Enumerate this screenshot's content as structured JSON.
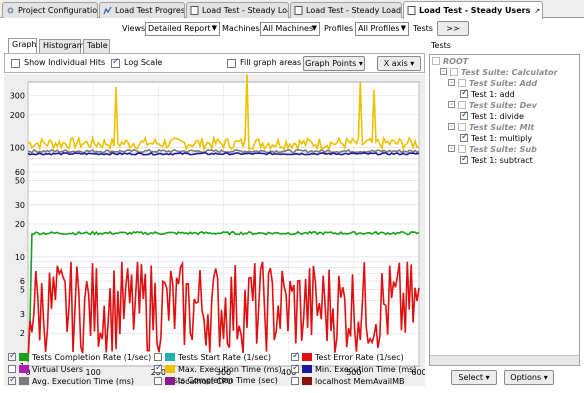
{
  "tabs": [
    {
      "label": "Project Configuration"
    },
    {
      "label": "Load Test Progress"
    },
    {
      "label": "Load Test - Steady Load"
    },
    {
      "label": "Load Test - Steady Load 2"
    },
    {
      "label": "Load Test - Steady Users"
    }
  ],
  "filters": {
    "views_label": "Views",
    "views_value": "Detailed Report",
    "machines_label": "Machines",
    "machines_value": "All Machines",
    "profiles_label": "Profiles",
    "profiles_value": "All Profiles",
    "tests_label": "Tests",
    "more_label": ">>"
  },
  "panel_tabs": [
    "Graph",
    "Histogram",
    "Table"
  ],
  "options": {
    "show_individual_hits": "Show Individual Hits",
    "show_individual_hits_checked": false,
    "log_scale": "Log Scale",
    "log_scale_checked": true,
    "fill_graph_areas": "Fill graph areas",
    "fill_graph_areas_checked": false,
    "graph_points": "Graph Points",
    "x_axis": "X axis"
  },
  "chart_data": {
    "type": "line",
    "xlabel": "Tests Completion Time (sec)",
    "ylabel": "",
    "xlim": [
      0,
      600
    ],
    "ylim": [
      1,
      400
    ],
    "log_y": true,
    "x_ticks": [
      0,
      100,
      200,
      300,
      400,
      500,
      600
    ],
    "y_ticks": [
      1,
      2,
      3,
      5,
      6,
      10,
      20,
      30,
      50,
      60,
      100,
      200,
      300
    ],
    "grid": true,
    "series": [
      {
        "name": "Max. Execution Time (ms)",
        "color": "#f0c000",
        "base": 110,
        "noise": 0.12,
        "spikes": [
          [
            135,
            360
          ],
          [
            335,
            470
          ],
          [
            510,
            400
          ],
          [
            530,
            340
          ]
        ]
      },
      {
        "name": "Avg. Execution Time (ms)",
        "color": "#7a7a7a",
        "base": 93,
        "noise": 0.03,
        "spikes": []
      },
      {
        "name": "Min. Execution Time (ms)",
        "color": "#1a1aa0",
        "base": 88,
        "noise": 0.02,
        "spikes": []
      },
      {
        "name": "Tests Completion Rate (1/sec)",
        "color": "#18a018",
        "base": 16.5,
        "noise": 0.03,
        "spikes": []
      },
      {
        "name": "Test Error Rate (1/sec)",
        "color": "#e01010",
        "base": 3.5,
        "noise": 0.45,
        "spikes": []
      }
    ]
  },
  "legend": [
    {
      "label": "Tests Completion Rate (1/sec)",
      "color": "#18a018",
      "checked": true
    },
    {
      "label": "Tests Start Rate (1/sec)",
      "color": "#20b0b0",
      "checked": false
    },
    {
      "label": "Test Error Rate (1/sec)",
      "color": "#e01010",
      "checked": true
    },
    {
      "label": "Virtual Users",
      "color": "#b020b0",
      "checked": false
    },
    {
      "label": "Max. Execution Time (ms)",
      "color": "#f0c000",
      "checked": true
    },
    {
      "label": "Min. Execution Time (ms)",
      "color": "#1a1aa0",
      "checked": true
    },
    {
      "label": "Avg. Execution Time (ms)",
      "color": "#7a7a7a",
      "checked": true
    },
    {
      "label": "localhost CPU",
      "color": "#8a1a8a",
      "checked": false
    },
    {
      "label": "localhost MemAvailMB",
      "color": "#8a1010",
      "checked": false
    }
  ],
  "tests_panel": {
    "title": "Tests",
    "tree": [
      {
        "label": "ROOT",
        "kind": "grey",
        "checked": false,
        "exp": ""
      },
      {
        "label": "Test Suite: Calculator",
        "kind": "grey",
        "checked": false,
        "exp": "-"
      },
      {
        "label": "Test Suite: Add",
        "kind": "grey",
        "checked": false,
        "exp": "-"
      },
      {
        "label": "Test 1: add",
        "kind": "leaf",
        "checked": true,
        "exp": ""
      },
      {
        "label": "Test Suite: Dev",
        "kind": "grey",
        "checked": false,
        "exp": "-"
      },
      {
        "label": "Test 1: divide",
        "kind": "leaf",
        "checked": true,
        "exp": ""
      },
      {
        "label": "Test Suite: Mlt",
        "kind": "grey",
        "checked": false,
        "exp": "-"
      },
      {
        "label": "Test 1: multiply",
        "kind": "leaf",
        "checked": true,
        "exp": ""
      },
      {
        "label": "Test Suite: Sub",
        "kind": "grey",
        "checked": false,
        "exp": "-"
      },
      {
        "label": "Test 1: subtract",
        "kind": "leaf",
        "checked": true,
        "exp": ""
      }
    ],
    "select_label": "Select",
    "options_label": "Options"
  }
}
